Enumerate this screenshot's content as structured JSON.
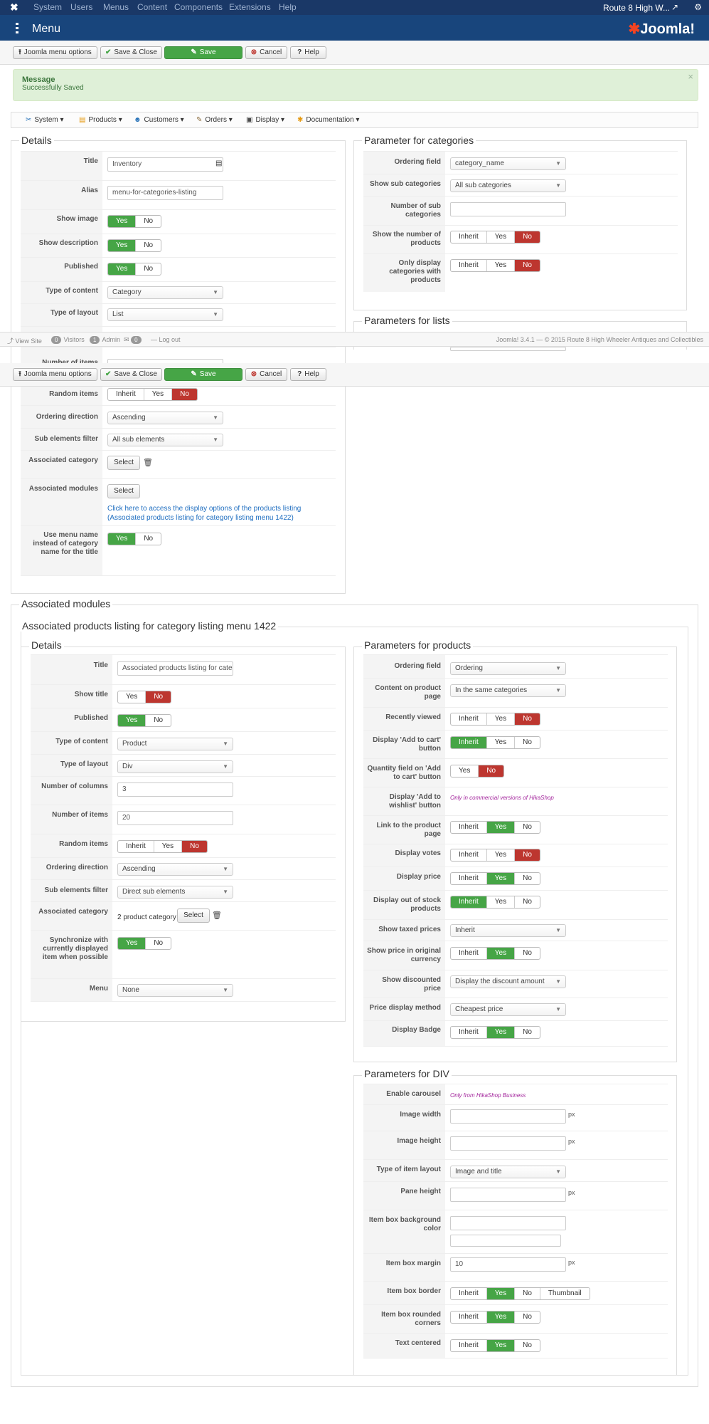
{
  "topbar": {
    "menus": [
      "System",
      "Users",
      "Menus",
      "Content",
      "Components",
      "Extensions",
      "Help"
    ],
    "site_name": "Route 8 High W..."
  },
  "header": {
    "title": "Menu",
    "logo_text": "Joomla!"
  },
  "toolbar": {
    "menu_options": "Joomla menu options",
    "save_close": "Save & Close",
    "save": "Save",
    "cancel": "Cancel",
    "help": "Help"
  },
  "message": {
    "heading": "Message",
    "text": "Successfully Saved"
  },
  "hikamenu": [
    "System",
    "Products",
    "Customers",
    "Orders",
    "Display",
    "Documentation"
  ],
  "details": {
    "legend": "Details",
    "title_label": "Title",
    "title_value": "Inventory",
    "alias_label": "Alias",
    "alias_value": "menu-for-categories-listing",
    "show_image_label": "Show image",
    "show_description_label": "Show description",
    "published_label": "Published",
    "type_content_label": "Type of content",
    "type_content_value": "Category",
    "type_layout_label": "Type of layout",
    "type_layout_value": "List",
    "number_items_label": "Number of items",
    "random_items_label": "Random items",
    "ordering_direction_label": "Ordering direction",
    "ordering_direction_value": "Ascending",
    "sub_elements_label": "Sub elements filter",
    "sub_elements_value": "All sub elements",
    "assoc_category_label": "Associated category",
    "assoc_modules_label": "Associated modules",
    "assoc_modules_link": "Click here to access the display options of the products listing (Associated products listing for category listing menu 1422)",
    "use_menu_name_label": "Use menu name instead of category name for the title",
    "select": "Select"
  },
  "toggles": {
    "yes": "Yes",
    "no": "No",
    "inherit": "Inherit",
    "thumbnail": "Thumbnail"
  },
  "param_categories": {
    "legend": "Parameter for categories",
    "ordering_field_label": "Ordering field",
    "ordering_field_value": "category_name",
    "show_sub_label": "Show sub categories",
    "show_sub_value": "All sub categories",
    "number_sub_label": "Number of sub categories",
    "show_number_label": "Show the number of products",
    "only_display_label": "Only display categories with products"
  },
  "param_lists": {
    "legend": "Parameters for lists"
  },
  "status": {
    "view_site": "View Site",
    "visitors_count": "0",
    "visitors": "Visitors",
    "admin_count": "1",
    "admin": "Admin",
    "msg_count": "0",
    "logout": "Log out",
    "copyright": "Joomla! 3.4.1 — © 2015 Route 8 High Wheeler Antiques and Collectibles"
  },
  "assoc": {
    "legend": "Associated modules",
    "inner_legend": "Associated products listing for category listing menu 1422",
    "details_legend": "Details",
    "title_label": "Title",
    "title_value": "Associated products listing for cate",
    "show_title_label": "Show title",
    "published_label": "Published",
    "type_content_label": "Type of content",
    "type_content_value": "Product",
    "type_layout_label": "Type of layout",
    "type_layout_value": "Div",
    "columns_label": "Number of columns",
    "columns_value": "3",
    "items_label": "Number of items",
    "items_value": "20",
    "random_label": "Random items",
    "ordering_label": "Ordering direction",
    "ordering_value": "Ascending",
    "sub_label": "Sub elements filter",
    "sub_value": "Direct sub elements",
    "category_label": "Associated category",
    "category_value": "2 product category",
    "sync_label": "Synchronize with currently displayed item when possible",
    "menu_label": "Menu",
    "menu_value": "None"
  },
  "param_products": {
    "legend": "Parameters for products",
    "ordering_field_label": "Ordering field",
    "ordering_field_value": "Ordering",
    "content_label": "Content on product page",
    "content_value": "In the same categories",
    "recently_label": "Recently viewed",
    "add_cart_label": "Display 'Add to cart' button",
    "qty_label": "Quantity field on 'Add to cart' button",
    "wishlist_label": "Display 'Add to wishlist' button",
    "wishlist_note": "Only in commercial versions of HikaShop",
    "link_label": "Link to the product page",
    "votes_label": "Display votes",
    "price_label": "Display price",
    "stock_label": "Display out of stock products",
    "taxed_label": "Show taxed prices",
    "taxed_value": "Inherit",
    "orig_currency_label": "Show price in original currency",
    "discounted_label": "Show discounted price",
    "discounted_value": "Display the discount amount",
    "price_method_label": "Price display method",
    "price_method_value": "Cheapest price",
    "badge_label": "Display Badge"
  },
  "param_div": {
    "legend": "Parameters for DIV",
    "carousel_label": "Enable carousel",
    "carousel_note": "Only from HikaShop Business",
    "img_width_label": "Image width",
    "img_height_label": "Image height",
    "px": "px",
    "item_layout_label": "Type of item layout",
    "item_layout_value": "Image and title",
    "pane_label": "Pane height",
    "bg_label": "Item box background color",
    "margin_label": "Item box margin",
    "margin_value": "10",
    "border_label": "Item box border",
    "rounded_label": "Item box rounded corners",
    "centered_label": "Text centered"
  }
}
